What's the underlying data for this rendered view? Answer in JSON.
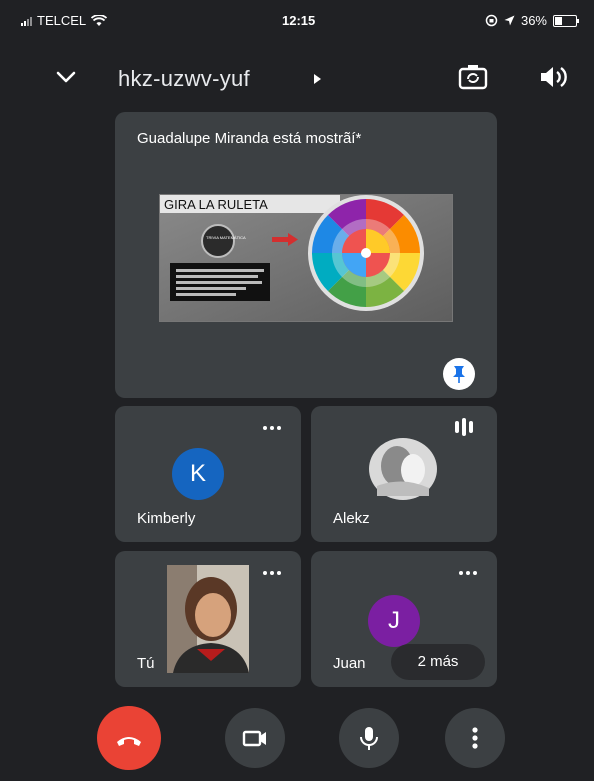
{
  "status_bar": {
    "carrier": "TELCEL",
    "time": "12:15",
    "battery": "36%",
    "battery_level": 0.36
  },
  "header": {
    "meeting_code": "hkz-uzwv-yuf",
    "icons": [
      "chevron-down-icon",
      "switch-camera-icon",
      "speaker-icon"
    ]
  },
  "presentation": {
    "label": "Guadalupe Miranda está mostrãí*",
    "slide": {
      "title": "GIRA LA RULETA",
      "badge": "TRIVIA MATEMÁTICA"
    },
    "pin_icon": "pin-icon"
  },
  "participants": [
    {
      "name": "Kimberly",
      "initial": "K",
      "avatar_color": "#1565c0",
      "menu_icon": "more-horiz-icon"
    },
    {
      "name": "Alekz",
      "audio_icon": "audio-level-icon"
    },
    {
      "name": "Tú",
      "menu_icon": "more-horiz-icon"
    },
    {
      "name": "Juan",
      "initial": "J",
      "avatar_color": "#7b1fa2",
      "menu_icon": "more-horiz-icon"
    }
  ],
  "more_participants": "2 más",
  "controls": {
    "end_call_color": "#ea4335",
    "icons": [
      "end-call-icon",
      "camera-icon",
      "mic-icon",
      "more-vert-icon"
    ]
  }
}
